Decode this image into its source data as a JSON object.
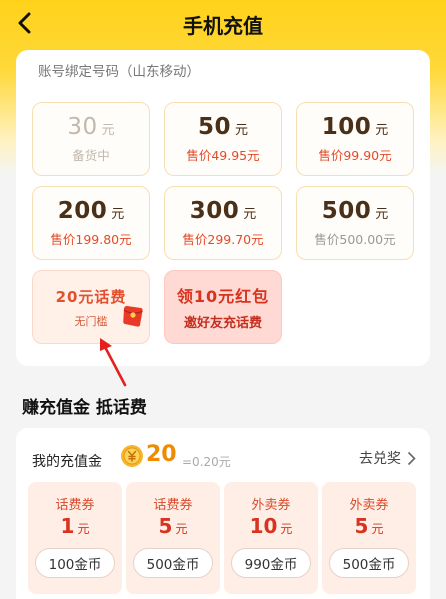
{
  "header": {
    "title": "手机充值"
  },
  "account": {
    "label": "账号绑定号码（山东移动）"
  },
  "amounts": [
    {
      "value": "30",
      "unit": "元",
      "price": "备货中"
    },
    {
      "value": "50",
      "unit": "元",
      "price": "售价49.95元"
    },
    {
      "value": "100",
      "unit": "元",
      "price": "售价99.90元"
    },
    {
      "value": "200",
      "unit": "元",
      "price": "售价199.80元"
    },
    {
      "value": "300",
      "unit": "元",
      "price": "售价299.70元"
    },
    {
      "value": "500",
      "unit": "元",
      "price": "售价500.00元"
    }
  ],
  "promos": [
    {
      "title": "20元话费",
      "subtitle": "无门槛"
    },
    {
      "title": "领10元红包",
      "subtitle": "邀好友充话费"
    }
  ],
  "earn": {
    "section_title": "赚充值金 抵话费",
    "my_gold_label": "我的充值金",
    "gold_count": "20",
    "gold_value": "=0.20元",
    "redeem_label": "去兑奖",
    "coupons": [
      {
        "type": "话费券",
        "amount": "1",
        "unit": "元",
        "cost": "100金币"
      },
      {
        "type": "话费券",
        "amount": "5",
        "unit": "元",
        "cost": "500金币"
      },
      {
        "type": "外卖券",
        "amount": "10",
        "unit": "元",
        "cost": "990金币"
      },
      {
        "type": "外卖券",
        "amount": "5",
        "unit": "元",
        "cost": "500金币"
      }
    ]
  },
  "colors": {
    "brand_yellow": "#ffd21a",
    "price_red": "#e24a2a",
    "gold_orange": "#f08a00",
    "tile_border": "#f7dfb4",
    "annotation_red": "#e5201c"
  },
  "icons": {
    "back": "chevron-left-icon",
    "envelope": "red-envelope-icon",
    "coin": "yuan-coin-icon",
    "redeem": "chevron-right-icon"
  }
}
